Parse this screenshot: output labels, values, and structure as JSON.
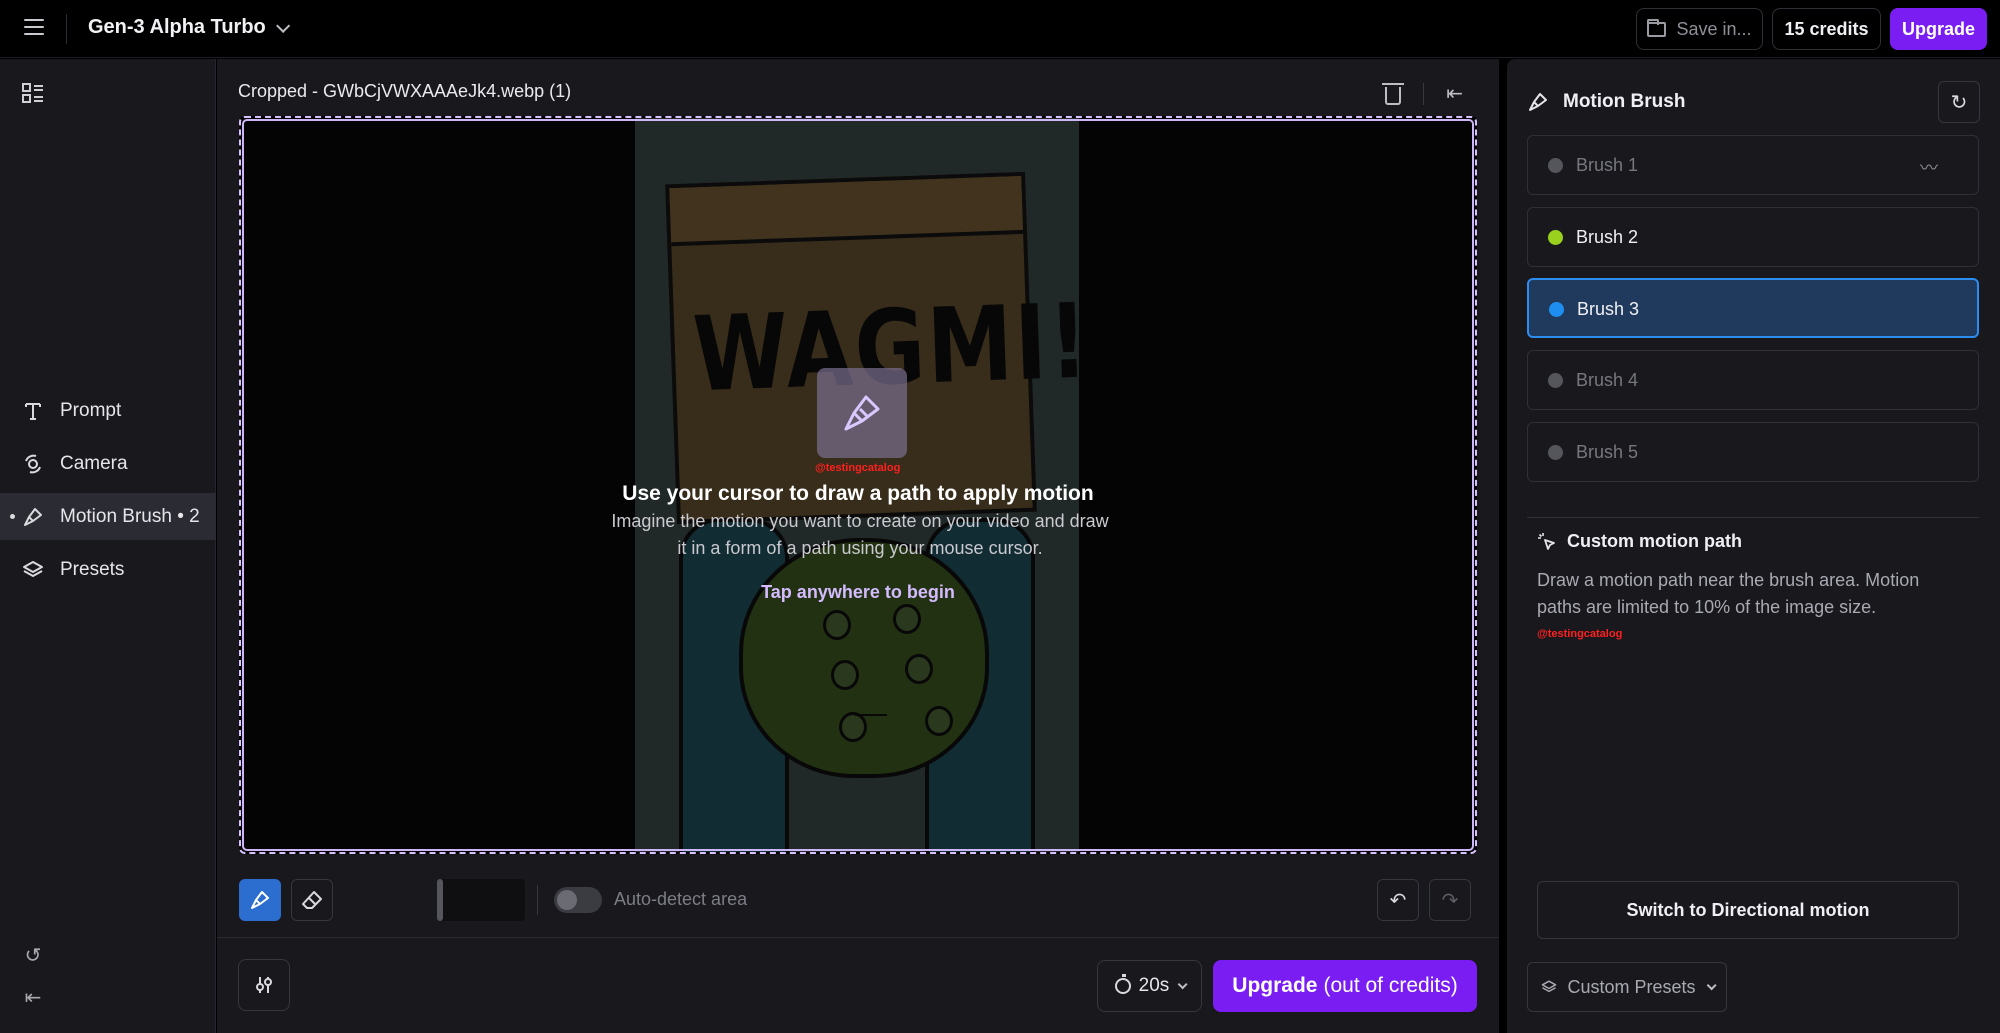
{
  "topbar": {
    "model_name": "Gen-3 Alpha Turbo",
    "save_label": "Save in...",
    "credits_label": "15 credits",
    "upgrade_label": "Upgrade"
  },
  "sidebar": {
    "items": [
      {
        "label": "Prompt",
        "icon": "text-icon"
      },
      {
        "label": "Camera",
        "icon": "camera-move-icon"
      },
      {
        "label": "Motion Brush • 2",
        "icon": "brush-icon",
        "active": true
      },
      {
        "label": "Presets",
        "icon": "layers-icon"
      }
    ]
  },
  "main": {
    "file_title": "Cropped - GWbCjVWXAAAeJk4.webp (1)",
    "sign_text": "WAGMI!",
    "overlay": {
      "watermark": "@testingcatalog",
      "title": "Use your cursor to draw a path to apply motion",
      "description": "Imagine the motion you want to create on your video and draw it in a form of a path using your mouse cursor.",
      "begin": "Tap anywhere to begin"
    },
    "toolbar": {
      "auto_detect_label": "Auto-detect area",
      "auto_detect_on": false
    },
    "duration": "20s",
    "generate": {
      "strong": "Upgrade",
      "rest": "(out of credits)"
    }
  },
  "right_panel": {
    "title": "Motion Brush",
    "brushes": [
      {
        "label": "Brush 1",
        "color": "#55555c",
        "text_color": "#77777f",
        "selected": false
      },
      {
        "label": "Brush 2",
        "color": "#9ad11e",
        "text_color": "#f0f0f4",
        "selected": false
      },
      {
        "label": "Brush 3",
        "color": "#1e8ff0",
        "text_color": "#f0f0f4",
        "selected": true
      },
      {
        "label": "Brush 4",
        "color": "#55555c",
        "text_color": "#77777f",
        "selected": false
      },
      {
        "label": "Brush 5",
        "color": "#55555c",
        "text_color": "#77777f",
        "selected": false
      }
    ],
    "custom_motion_title": "Custom motion path",
    "custom_motion_desc": "Draw a motion path near the brush area. Motion paths are limited to 10% of the image size.",
    "watermark": "@testingcatalog",
    "switch_label": "Switch to Directional motion",
    "presets_label": "Custom Presets"
  },
  "colors": {
    "accent": "#7a1df3",
    "selected_blue": "#2e8cf0",
    "canvas_border": "#d7c2ff"
  }
}
